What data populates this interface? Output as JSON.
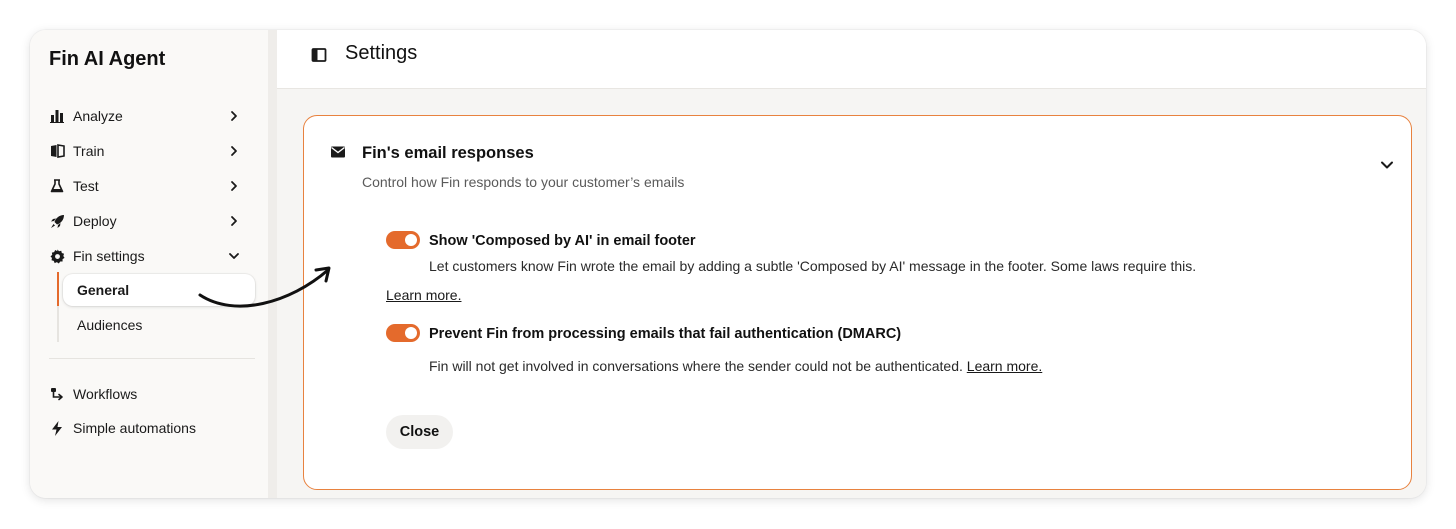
{
  "sidebar": {
    "app_title": "Fin AI Agent",
    "items": [
      {
        "label": "Analyze",
        "icon": "bar-chart-icon"
      },
      {
        "label": "Train",
        "icon": "book-icon"
      },
      {
        "label": "Test",
        "icon": "flask-icon"
      },
      {
        "label": "Deploy",
        "icon": "rocket-icon"
      },
      {
        "label": "Fin settings",
        "icon": "gear-icon"
      }
    ],
    "subitems": [
      {
        "label": "General",
        "active": true
      },
      {
        "label": "Audiences",
        "active": false
      }
    ],
    "bottom_items": [
      {
        "label": "Workflows",
        "icon": "workflow-icon"
      },
      {
        "label": "Simple automations",
        "icon": "lightning-icon"
      }
    ]
  },
  "header": {
    "title": "Settings"
  },
  "card": {
    "title": "Fin's email responses",
    "subtitle": "Control how Fin responds to your customer’s emails",
    "options": [
      {
        "title": "Show 'Composed by AI' in email footer",
        "description": "Let customers know Fin wrote the email by adding a subtle 'Composed by AI' message in the footer. Some laws require this.",
        "link": "Learn more.",
        "enabled": true
      },
      {
        "title": "Prevent Fin from processing emails that fail authentication (DMARC)",
        "description": "Fin will not get involved in conversations where the sender could not be authenticated.",
        "link": "Learn more.",
        "enabled": true
      }
    ],
    "close_label": "Close"
  },
  "colors": {
    "accent": "#e46a2c",
    "card_border": "#e8823f"
  }
}
